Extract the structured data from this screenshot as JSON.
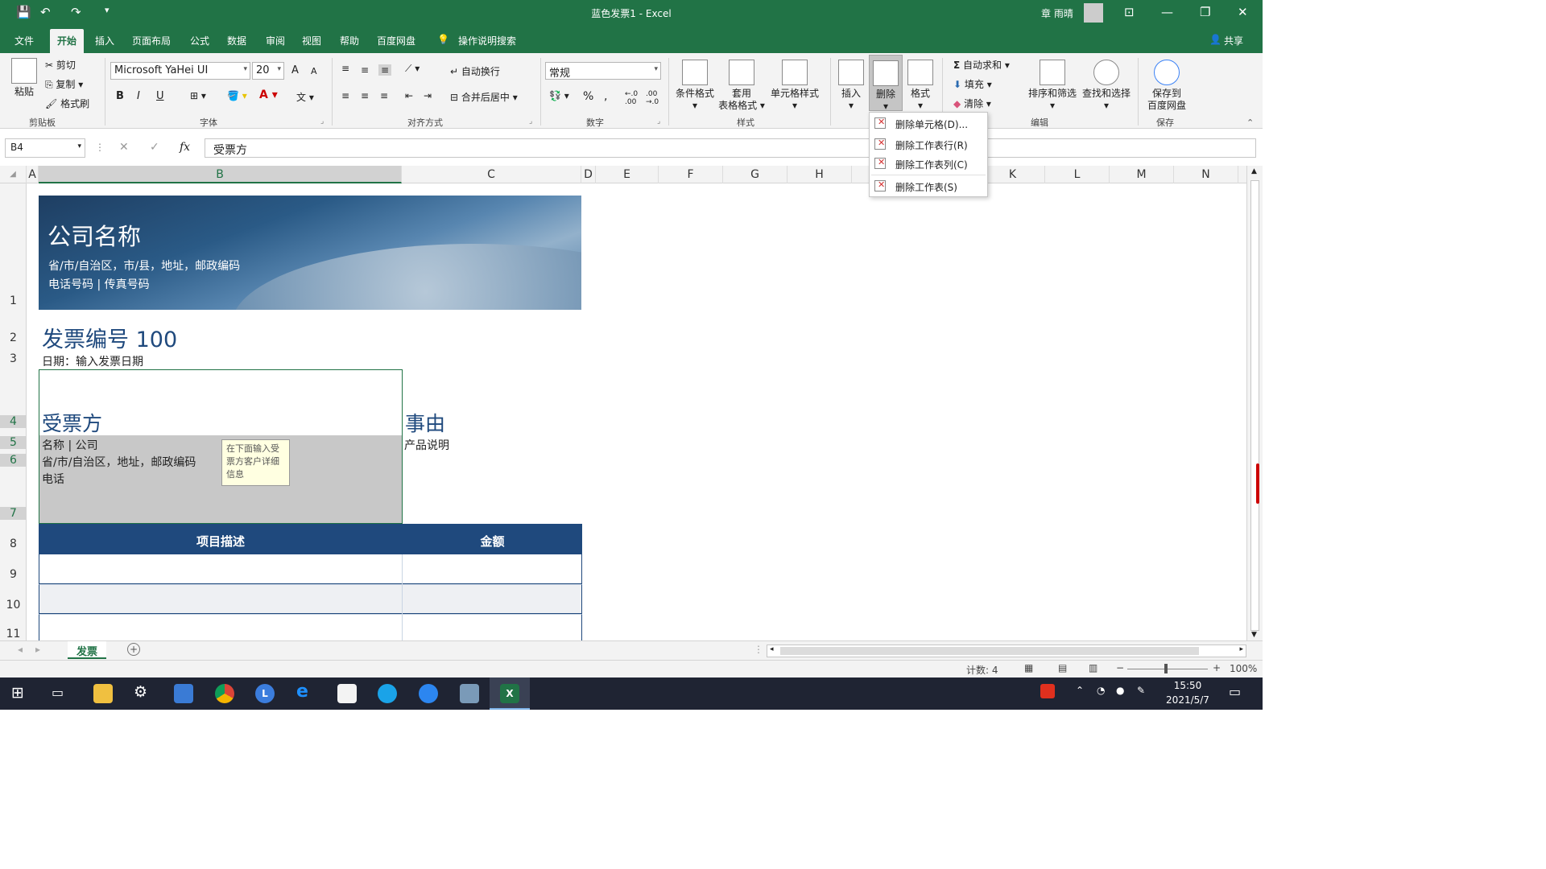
{
  "titlebar": {
    "doc_title": "蓝色发票1 - Excel",
    "user": "章 雨晴"
  },
  "tabs": [
    "文件",
    "开始",
    "插入",
    "页面布局",
    "公式",
    "数据",
    "审阅",
    "视图",
    "帮助",
    "百度网盘"
  ],
  "active_tab": "开始",
  "tell_me": "操作说明搜索",
  "share": "共享",
  "clipboard": {
    "paste": "粘贴",
    "cut": "剪切",
    "copy": "复制",
    "painter": "格式刷",
    "group": "剪贴板"
  },
  "font": {
    "name": "Microsoft YaHei UI",
    "size": "20",
    "bold": "B",
    "italic": "I",
    "underline": "U",
    "grow": "A",
    "shrink": "A",
    "group": "字体"
  },
  "alignment": {
    "wrap": "自动换行",
    "merge": "合并后居中",
    "group": "对齐方式"
  },
  "number": {
    "format": "常规",
    "percent": "%",
    "group": "数字"
  },
  "styles": {
    "conditional": "条件格式",
    "table_l1": "套用",
    "table_l2": "表格格式",
    "cell": "单元格样式",
    "group": "样式"
  },
  "cells": {
    "insert": "插入",
    "delete": "删除",
    "format": "格式"
  },
  "editing": {
    "autosum": "自动求和",
    "fill": "填充",
    "clear": "清除",
    "sort": "排序和筛选",
    "find": "查找和选择",
    "group": "编辑"
  },
  "save": {
    "l1": "保存到",
    "l2": "百度网盘",
    "group": "保存"
  },
  "delete_menu": [
    "删除单元格(D)...",
    "删除工作表行(R)",
    "删除工作表列(C)",
    "删除工作表(S)"
  ],
  "formula_bar": {
    "cell_ref": "B4",
    "fx": "fx",
    "value": "受票方"
  },
  "columns": [
    "A",
    "B",
    "C",
    "D",
    "E",
    "F",
    "G",
    "H",
    "K",
    "L",
    "M",
    "N"
  ],
  "rows": [
    "1",
    "2",
    "3",
    "4",
    "5",
    "6",
    "7",
    "8",
    "9",
    "10",
    "11"
  ],
  "invoice": {
    "company": "公司名称",
    "address": "省/市/自治区，市/县，地址，邮政编码",
    "phone_fax": "电话号码 | 传真号码",
    "number_label": "发票编号 100",
    "date": "日期：输入发票日期",
    "bill_to": "受票方",
    "purpose": "事由",
    "name_company": "名称 | 公司",
    "recipient_address": "省/市/自治区，地址，邮政编码",
    "phone": "电话",
    "product_desc": "产品说明",
    "col_desc": "项目描述",
    "col_amount": "金额"
  },
  "tooltip": "在下面输入受票方客户详细信息",
  "sheet_tab": "发票",
  "status": {
    "count": "计数: 4",
    "zoom": "100%"
  },
  "clock": {
    "time": "15:50",
    "date": "2021/5/7"
  },
  "colors": {
    "excel_green": "#217346",
    "invoice_blue": "#1f497d",
    "header_fill": "#1f497d"
  }
}
